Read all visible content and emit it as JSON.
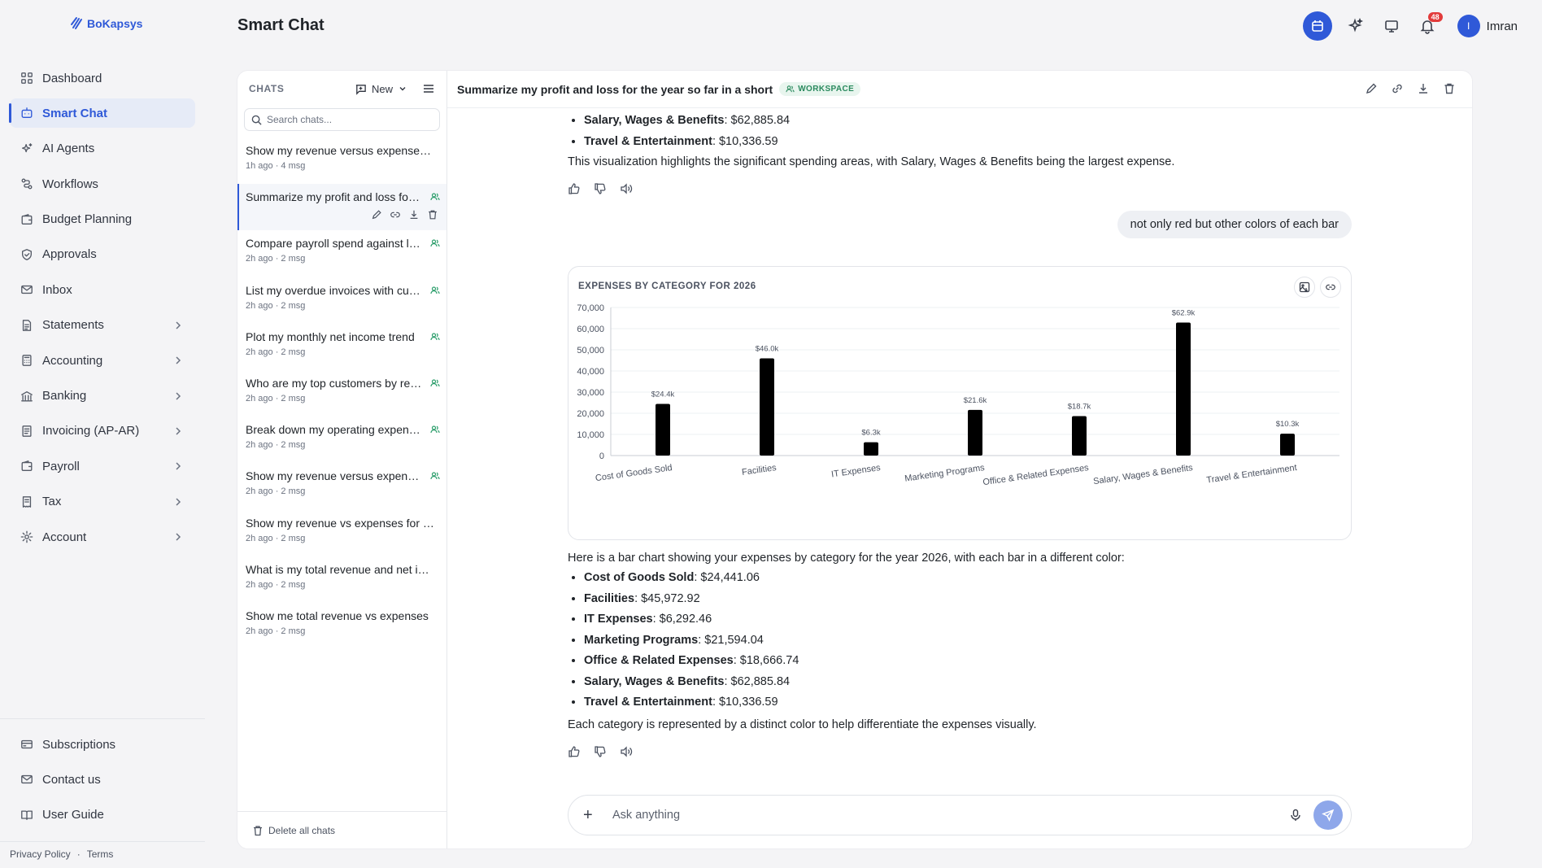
{
  "app": {
    "logo_text": "BoKapsys",
    "page_title": "Smart Chat"
  },
  "sidebar": {
    "items": [
      {
        "label": "Dashboard",
        "icon": "grid-icon",
        "has_chevron": false,
        "active": false
      },
      {
        "label": "Smart Chat",
        "icon": "chat-bot-icon",
        "has_chevron": false,
        "active": true
      },
      {
        "label": "AI Agents",
        "icon": "sparkles-icon",
        "has_chevron": false,
        "active": false
      },
      {
        "label": "Workflows",
        "icon": "workflow-icon",
        "has_chevron": false,
        "active": false
      },
      {
        "label": "Budget Planning",
        "icon": "wallet-icon",
        "has_chevron": false,
        "active": false
      },
      {
        "label": "Approvals",
        "icon": "shield-check-icon",
        "has_chevron": false,
        "active": false
      },
      {
        "label": "Inbox",
        "icon": "mail-icon",
        "has_chevron": false,
        "active": false
      },
      {
        "label": "Statements",
        "icon": "document-icon",
        "has_chevron": true,
        "active": false
      },
      {
        "label": "Accounting",
        "icon": "calculator-icon",
        "has_chevron": true,
        "active": false
      },
      {
        "label": "Banking",
        "icon": "bank-icon",
        "has_chevron": true,
        "active": false
      },
      {
        "label": "Invoicing (AP-AR)",
        "icon": "invoice-icon",
        "has_chevron": true,
        "active": false
      },
      {
        "label": "Payroll",
        "icon": "wallet-icon",
        "has_chevron": true,
        "active": false
      },
      {
        "label": "Tax",
        "icon": "receipt-icon",
        "has_chevron": true,
        "active": false
      },
      {
        "label": "Account",
        "icon": "gear-icon",
        "has_chevron": true,
        "active": false
      }
    ],
    "bottom_items": [
      {
        "label": "Subscriptions",
        "icon": "card-icon"
      },
      {
        "label": "Contact us",
        "icon": "mail-icon"
      },
      {
        "label": "User Guide",
        "icon": "book-icon"
      }
    ],
    "footer": {
      "privacy": "Privacy Policy",
      "sep": "·",
      "terms": "Terms"
    }
  },
  "header": {
    "notification_count": "48",
    "user_initial": "I",
    "user_name": "Imran"
  },
  "chats_panel": {
    "title": "CHATS",
    "new_label": "New",
    "search_placeholder": "Search chats...",
    "delete_all": "Delete all chats",
    "items": [
      {
        "title": "Show my revenue versus expenses for the year",
        "meta": "1h ago · 4 msg",
        "shared": false,
        "active": false
      },
      {
        "title": "Summarize my profit and loss for the year so far in a short",
        "meta": "",
        "shared": true,
        "active": true
      },
      {
        "title": "Compare payroll spend against last year",
        "meta": "2h ago · 2 msg",
        "shared": true,
        "active": false
      },
      {
        "title": "List my overdue invoices with customer names",
        "meta": "2h ago · 2 msg",
        "shared": true,
        "active": false
      },
      {
        "title": "Plot my monthly net income trend",
        "meta": "2h ago · 2 msg",
        "shared": true,
        "active": false
      },
      {
        "title": "Who are my top customers by revenue",
        "meta": "2h ago · 2 msg",
        "shared": true,
        "active": false
      },
      {
        "title": "Break down my operating expenses",
        "meta": "2h ago · 2 msg",
        "shared": true,
        "active": false
      },
      {
        "title": "Show my revenue versus expenses by month",
        "meta": "2h ago · 2 msg",
        "shared": true,
        "active": false
      },
      {
        "title": "Show my revenue vs expenses for this year",
        "meta": "2h ago · 2 msg",
        "shared": false,
        "active": false
      },
      {
        "title": "What is my total revenue and net income",
        "meta": "2h ago · 2 msg",
        "shared": false,
        "active": false
      },
      {
        "title": "Show me total revenue vs expenses",
        "meta": "2h ago · 2 msg",
        "shared": false,
        "active": false
      }
    ]
  },
  "conversation": {
    "title": "Summarize my profit and loss for the year so far in a short",
    "badge": "WORKSPACE",
    "top_bullets": [
      {
        "label": "Salary, Wages & Benefits",
        "value": ": $62,885.84"
      },
      {
        "label": "Travel & Entertainment",
        "value": ": $10,336.59"
      }
    ],
    "top_summary": "This visualization highlights the significant spending areas, with Salary, Wages & Benefits being the largest expense.",
    "user_message": "not only red but other colors of each bar",
    "reply_intro": "Here is a bar chart showing your expenses by category for the year 2026, with each bar in a different color:",
    "reply_bullets": [
      {
        "label": "Cost of Goods Sold",
        "value": ": $24,441.06"
      },
      {
        "label": "Facilities",
        "value": ": $45,972.92"
      },
      {
        "label": "IT Expenses",
        "value": ": $6,292.46"
      },
      {
        "label": "Marketing Programs",
        "value": ": $21,594.04"
      },
      {
        "label": "Office & Related Expenses",
        "value": ": $18,666.74"
      },
      {
        "label": "Salary, Wages & Benefits",
        "value": ": $62,885.84"
      },
      {
        "label": "Travel & Entertainment",
        "value": ": $10,336.59"
      }
    ],
    "reply_summary": "Each category is represented by a distinct color to help differentiate the expenses visually.",
    "composer_placeholder": "Ask anything"
  },
  "chart_data": {
    "type": "bar",
    "title": "EXPENSES BY CATEGORY FOR 2026",
    "categories": [
      "Cost of Goods Sold",
      "Facilities",
      "IT Expenses",
      "Marketing Programs",
      "Office & Related Expenses",
      "Salary, Wages & Benefits",
      "Travel & Entertainment"
    ],
    "values": [
      24441.06,
      45972.92,
      6292.46,
      21594.04,
      18666.74,
      62885.84,
      10336.59
    ],
    "data_labels": [
      "$24.4k",
      "$46.0k",
      "$6.3k",
      "$21.6k",
      "$18.7k",
      "$62.9k",
      "$10.3k"
    ],
    "yticks": [
      "0",
      "10,000",
      "20,000",
      "30,000",
      "40,000",
      "50,000",
      "60,000",
      "70,000"
    ],
    "ylim": [
      0,
      70000
    ],
    "grid": true,
    "bar_color": "#000000"
  },
  "colors": {
    "accent": "#2f59d8",
    "workspace_green": "#2a8a5e",
    "badge_red": "#e23b3b"
  }
}
